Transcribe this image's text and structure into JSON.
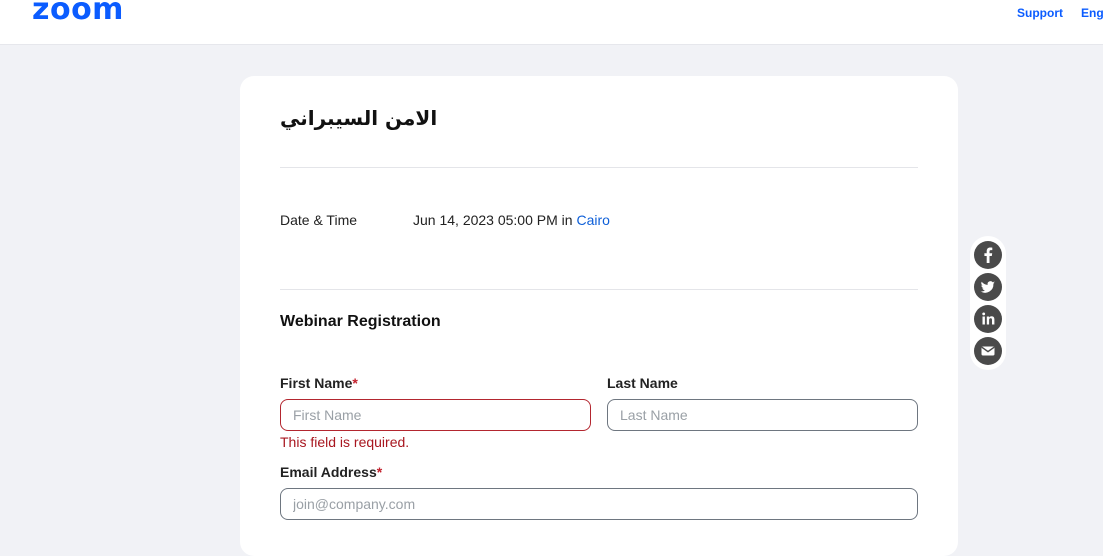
{
  "header": {
    "logo": "zoom",
    "support_label": "Support",
    "language_label": "Engl"
  },
  "event": {
    "title": "الامن السيبراني",
    "datetime_label": "Date & Time",
    "datetime_value": "Jun 14, 2023 05:00 PM in ",
    "timezone_city": "Cairo"
  },
  "registration": {
    "section_title": "Webinar Registration",
    "first_name": {
      "label": "First Name",
      "required_mark": "*",
      "placeholder": "First Name",
      "value": "",
      "error": "This field is required."
    },
    "last_name": {
      "label": "Last Name",
      "placeholder": "Last Name",
      "value": ""
    },
    "email": {
      "label": "Email Address",
      "required_mark": "*",
      "placeholder": "join@company.com",
      "value": ""
    }
  },
  "share": {
    "icons": [
      "facebook-icon",
      "twitter-icon",
      "linkedin-icon",
      "email-icon"
    ]
  },
  "colors": {
    "brand": "#0b5cff",
    "error": "#a8161f",
    "link": "#0e5fd8",
    "background": "#f1f2f6"
  }
}
